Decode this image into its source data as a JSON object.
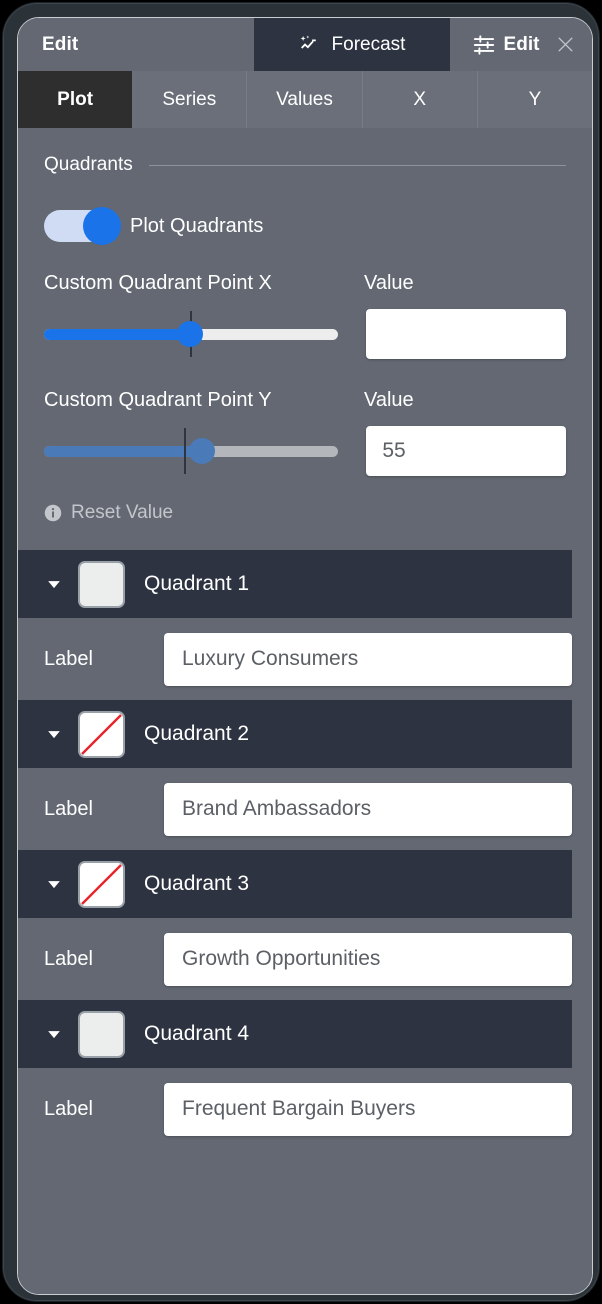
{
  "header": {
    "left_title": "Edit",
    "forecast_tab": "Forecast",
    "forecast_icon": "sparkle-trend-icon",
    "right_title": "Edit",
    "right_icon": "sliders-tune-icon",
    "close_icon": "close-icon"
  },
  "tabs": [
    {
      "label": "Plot",
      "active": true
    },
    {
      "label": "Series",
      "active": false
    },
    {
      "label": "Values",
      "active": false
    },
    {
      "label": "X",
      "active": false
    },
    {
      "label": "Y",
      "active": false
    }
  ],
  "quadrants_section": {
    "title": "Quadrants",
    "toggle": {
      "label": "Plot Quadrants",
      "state": "on"
    },
    "slider_x": {
      "title": "Custom Quadrant Point X",
      "value_label": "Value",
      "value": "",
      "fill_percent": 48,
      "tick_percent": 48,
      "accent": "#1a73e8"
    },
    "slider_y": {
      "title": "Custom Quadrant Point Y",
      "value_label": "Value",
      "value": "55",
      "fill_percent": 52,
      "tick_percent": 46,
      "accent": "#4a7ab8"
    },
    "reset": {
      "label": "Reset Value",
      "icon": "info-icon"
    }
  },
  "quadrants": [
    {
      "title": "Quadrant 1",
      "swatch": "filled",
      "label_caption": "Label",
      "label_value": "Luxury Consumers"
    },
    {
      "title": "Quadrant 2",
      "swatch": "no-color",
      "label_caption": "Label",
      "label_value": "Brand Ambassadors"
    },
    {
      "title": "Quadrant 3",
      "swatch": "no-color",
      "label_caption": "Label",
      "label_value": "Growth Opportunities"
    },
    {
      "title": "Quadrant 4",
      "swatch": "filled",
      "label_caption": "Label",
      "label_value": "Frequent Bargain Buyers"
    }
  ],
  "colors": {
    "panel_bg": "#636872",
    "header_dark": "#2d3340",
    "tab_active_bg": "#2e2e2e",
    "accent_blue": "#1a73e8",
    "accent_blue_muted": "#4a7ab8",
    "no_color_slash": "#e8232a"
  }
}
